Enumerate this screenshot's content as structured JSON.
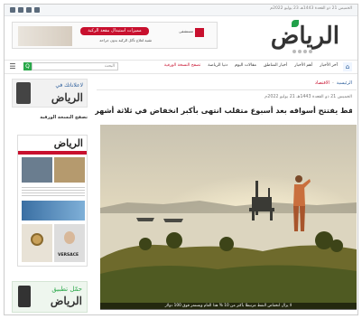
{
  "topbar": {
    "date": "الخميس 21 ذو القعدة 1443هـ 23 يوليو 2022م",
    "social_icons": [
      "facebook-icon",
      "twitter-icon",
      "youtube-icon",
      "instagram-icon"
    ]
  },
  "logo": {
    "text": "الرياض"
  },
  "banner": {
    "headline": "مميزات استبدال مقعد الركبة",
    "sub": "تقنية لعلاج تآكل الركبة بدون جراحة",
    "brand": "مستشفى"
  },
  "nav": {
    "home_icon": "home-icon",
    "items": [
      "آخر الأخبار",
      "أهم الأخبار",
      "أخبار المناطق",
      "مقالات اليوم",
      "دنيا الرياضة",
      "تصفح النسخة الورقية"
    ],
    "search_placeholder": "البحث",
    "search_button": "Q",
    "menu_icon": "☰"
  },
  "sidebar": {
    "ad_top": {
      "line1": "لاعلاناتك في",
      "line2": "الرياض"
    },
    "paper_label": "تصفح النسخة الورقية",
    "paper": {
      "masthead": "الرياض",
      "brand": "VERSACE"
    },
    "ad_bottom": {
      "line1": "حمّل تطبيق",
      "line2": "الرياض"
    }
  },
  "breadcrumb": {
    "home": "الرئيسية",
    "separator": "-",
    "section": "الاقتصاد"
  },
  "article": {
    "meta": "الخميس 21 ذو القعدة 1443هـ 21 يوليو 2022م",
    "headline": "النفط يفتتح أسواقه بعد أسبوع متقلب انتهى بأكبر انخفاض في ثلاثة أشهر",
    "caption": "لا يزال انخفاض النفط مرتبطا بأكثر من 10 % هذا العام ويستمر فوق 100 دولار"
  },
  "colors": {
    "brand_red": "#c8102e",
    "brand_green": "#2aa84a",
    "link_blue": "#2b5d9b"
  }
}
